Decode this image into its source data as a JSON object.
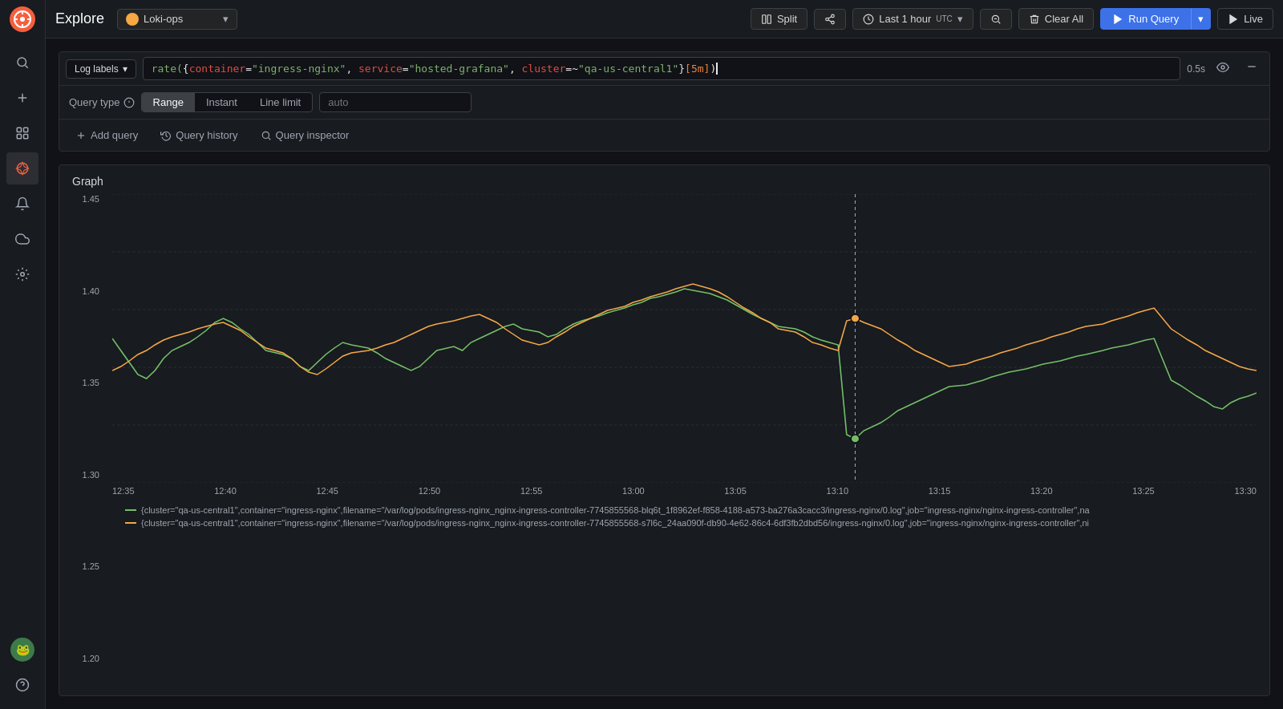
{
  "sidebar": {
    "logo_icon": "🔥",
    "items": [
      {
        "id": "search",
        "icon": "🔍",
        "active": false
      },
      {
        "id": "plus",
        "icon": "+",
        "active": false
      },
      {
        "id": "grid",
        "icon": "▦",
        "active": false
      },
      {
        "id": "compass",
        "icon": "◎",
        "active": true
      },
      {
        "id": "bell",
        "icon": "🔔",
        "active": false
      },
      {
        "id": "cloud",
        "icon": "☁",
        "active": false
      },
      {
        "id": "gear",
        "icon": "⚙",
        "active": false
      }
    ],
    "avatar_icon": "🐸"
  },
  "topbar": {
    "title": "Explore",
    "datasource": "Loki-ops",
    "split_label": "Split",
    "share_icon": "share",
    "time_range": "Last 1 hour",
    "time_utc": "UTC",
    "zoom_icon": "zoom",
    "clear_all_label": "Clear All",
    "run_query_label": "Run Query",
    "live_label": "Live"
  },
  "query_editor": {
    "log_labels_btn": "Log labels",
    "query_text_plain": "rate({container=\"ingress-nginx\", service=\"hosted-grafana\", cluster=~\"qa-us-central1\"}[5m])",
    "query_parts": {
      "fn": "rate(",
      "brace_open": "{",
      "key1": "container",
      "eq1": "=",
      "val1": "\"ingress-nginx\"",
      "sep1": ", ",
      "key2": "service",
      "eq2": "=",
      "val2": "\"hosted-grafana\"",
      "sep2": ", ",
      "key3": "cluster",
      "eq3": "=~",
      "val3": "\"qa-us-central1\"",
      "brace_close": "}",
      "time": "[5m]",
      "paren_close": ")"
    },
    "timer": "0.5s",
    "query_type_label": "Query type",
    "query_type_options": [
      "Range",
      "Instant",
      "Line limit"
    ],
    "query_type_active": "Range",
    "auto_placeholder": "auto",
    "add_query_label": "Add query",
    "query_history_label": "Query history",
    "query_inspector_label": "Query inspector"
  },
  "graph": {
    "title": "Graph",
    "y_labels": [
      "1.45",
      "1.40",
      "1.35",
      "1.30",
      "1.25",
      "1.20"
    ],
    "x_labels": [
      "12:35",
      "12:40",
      "12:45",
      "12:50",
      "12:55",
      "13:00",
      "13:05",
      "13:10",
      "13:15",
      "13:20",
      "13:25",
      "13:30"
    ],
    "colors": {
      "green": "#73bf69",
      "orange": "#f2a647"
    },
    "legend": [
      {
        "color": "#73bf69",
        "text": "{cluster=\"qa-us-central1\",container=\"ingress-nginx\",filename=\"/var/log/pods/ingress-nginx_nginx-ingress-controller-7745855568-blq6t_1f8962ef-f858-4188-a573-ba276a3cacc3/ingress-nginx/0.log\",job=\"ingress-nginx/nginx-ingress-controller\",na"
      },
      {
        "color": "#f2a647",
        "text": "{cluster=\"qa-us-central1\",container=\"ingress-nginx\",filename=\"/var/log/pods/ingress-nginx_nginx-ingress-controller-7745855568-s7l6c_24aa090f-db90-4e62-86c4-6df3fb2dbd56/ingress-nginx/0.log\",job=\"ingress-nginx/nginx-ingress-controller\",ni"
      }
    ]
  }
}
